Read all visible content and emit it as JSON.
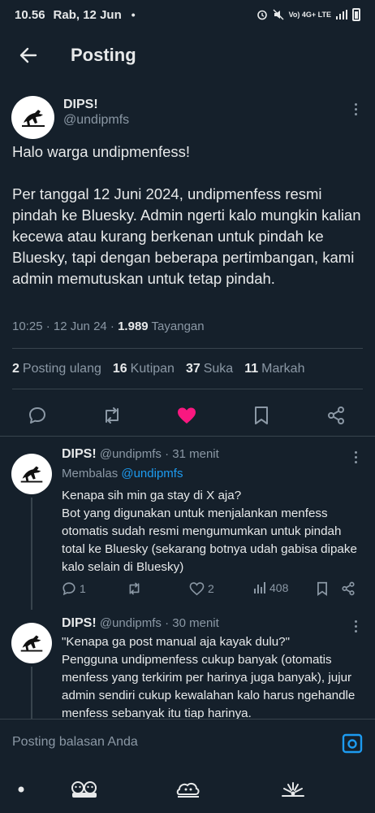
{
  "status_bar": {
    "time": "10.56",
    "date": "Rab, 12 Jun",
    "dot": "•",
    "network": "Vo) 4G+ LTE"
  },
  "header": {
    "title": "Posting"
  },
  "main_post": {
    "name": "DIPS!",
    "handle": "@undipmfs",
    "paragraphs": [
      "Halo warga undipmenfess!",
      "Per tanggal 12 Juni 2024, undipmenfess resmi pindah ke Bluesky. Admin ngerti kalo mungkin kalian kecewa atau kurang berkenan untuk pindah ke Bluesky, tapi dengan beberapa pertimbangan, kami admin memutuskan untuk tetap pindah."
    ],
    "timestamp": "10:25 · 12 Jun 24 · ",
    "views_count": "1.989",
    "views_label": " Tayangan",
    "stats": {
      "reposts_count": "2",
      "reposts_label": "Posting ulang",
      "quotes_count": "16",
      "quotes_label": "Kutipan",
      "likes_count": "37",
      "likes_label": "Suka",
      "bookmarks_count": "11",
      "bookmarks_label": "Markah"
    },
    "like_color": "#f91880"
  },
  "replies": [
    {
      "name": "DIPS!",
      "handle": "@undipmfs",
      "time": " · 31 menit",
      "replying_prefix": "Membalas ",
      "replying_to": "@undipmfs",
      "body": "Kenapa sih min ga stay di X aja?\nBot yang digunakan untuk menjalankan menfess otomatis sudah resmi mengumumkan untuk pindah total ke Bluesky (sekarang botnya udah gabisa dipake kalo selain di Bluesky)",
      "reply_count": "1",
      "repost_count": "",
      "like_count": "2",
      "view_count": "408"
    },
    {
      "name": "DIPS!",
      "handle": "@undipmfs",
      "time": " · 30 menit",
      "body": "\"Kenapa ga post manual aja kayak dulu?\"\nPengguna undipmenfess cukup banyak (otomatis menfess yang terkirim per harinya juga banyak), jujur admin sendiri cukup kewalahan kalo harus ngehandle menfess sebanyak itu tiap harinya."
    }
  ],
  "composer": {
    "placeholder": "Posting balasan Anda"
  },
  "colors": {
    "background": "#15202b",
    "text": "#e7e9ea",
    "muted": "#8b98a5",
    "link": "#1d9bf0",
    "divider": "#38444d"
  },
  "icons": [
    "back-arrow-icon",
    "more-icon",
    "reply-icon",
    "repost-icon",
    "heart-icon",
    "bookmark-icon",
    "share-icon",
    "views-icon",
    "camera-icon",
    "avatar-logo"
  ]
}
